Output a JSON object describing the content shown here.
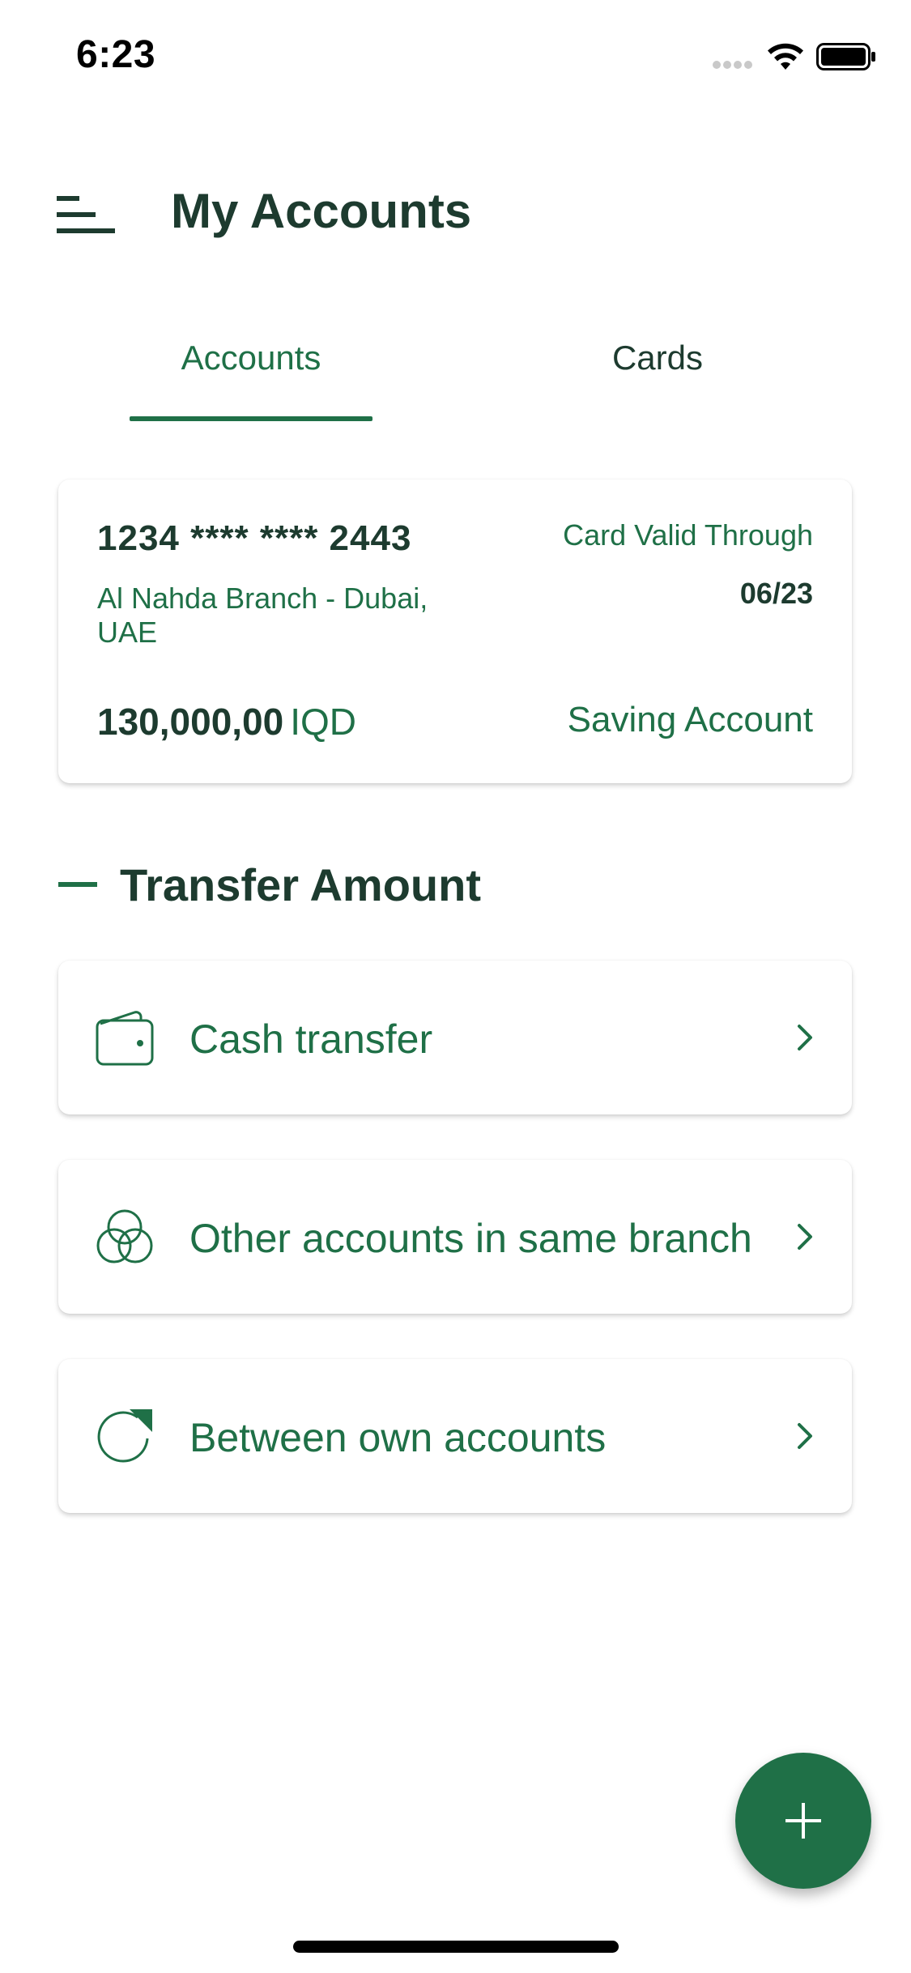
{
  "status_bar": {
    "time": "6:23"
  },
  "header": {
    "title": "My Accounts",
    "menu_icon": "menu-icon"
  },
  "tabs": [
    {
      "label": "Accounts",
      "active": true
    },
    {
      "label": "Cards",
      "active": false
    }
  ],
  "account_card": {
    "number": "1234 **** **** 2443",
    "branch": "Al Nahda Branch - Dubai, UAE",
    "valid_label": "Card Valid Through",
    "valid_date": "06/23",
    "balance_amount": "130,000,00",
    "currency": "IQD",
    "account_type": "Saving Account"
  },
  "transfer_section": {
    "title": "Transfer Amount",
    "options": [
      {
        "label": "Cash transfer",
        "icon": "wallet-icon"
      },
      {
        "label": "Other accounts in same branch",
        "icon": "circles-icon"
      },
      {
        "label": "Between own accounts",
        "icon": "refresh-icon"
      }
    ]
  },
  "fab": {
    "icon": "plus-icon"
  },
  "colors": {
    "primary": "#1f7047",
    "title_dark": "#1d3b2f",
    "background": "#ffffff"
  }
}
